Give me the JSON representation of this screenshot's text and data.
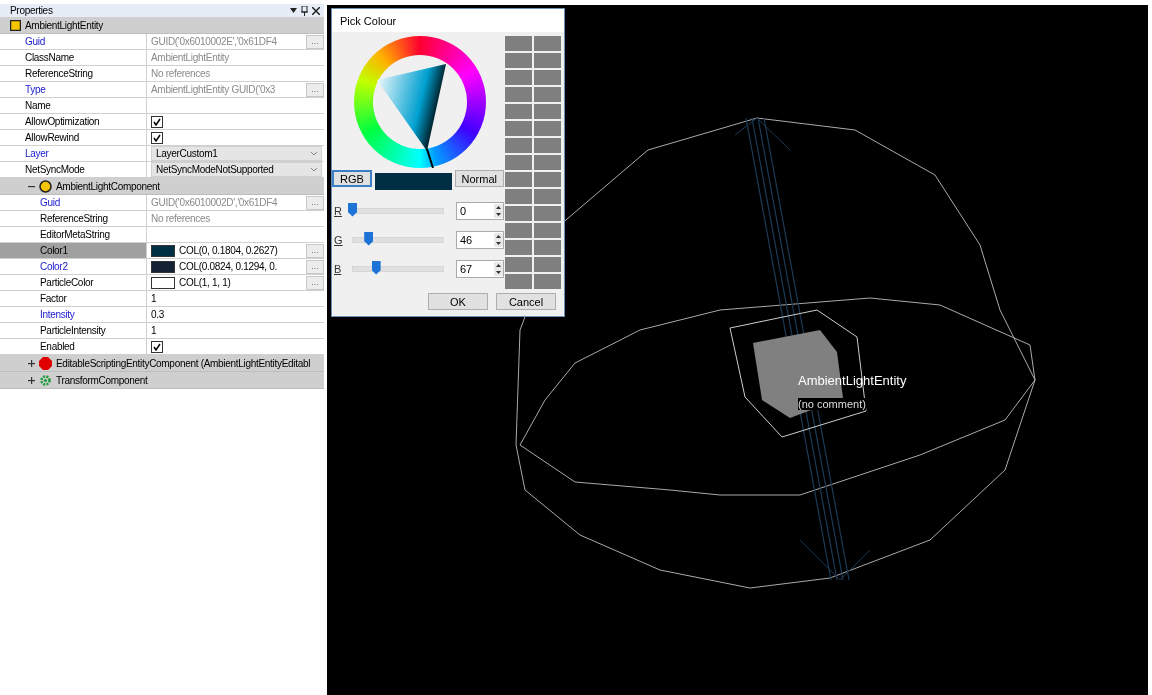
{
  "panel": {
    "title": "Properties",
    "entity": {
      "name": "AmbientLightEntity"
    },
    "rows": [
      {
        "kind": "readonly",
        "label": "Guid",
        "modified": true,
        "selected": false,
        "value": "GUID('0x6010002E','0x61DF4",
        "button": "..."
      },
      {
        "kind": "readonly",
        "label": "ClassName",
        "modified": false,
        "selected": false,
        "value": "AmbientLightEntity"
      },
      {
        "kind": "readonly",
        "label": "ReferenceString",
        "modified": false,
        "selected": false,
        "value": "No references"
      },
      {
        "kind": "readonly",
        "label": "Type",
        "modified": true,
        "selected": false,
        "value": "AmbientLightEntity GUID('0x3",
        "button": "..."
      },
      {
        "kind": "text",
        "label": "Name",
        "modified": false,
        "selected": false
      },
      {
        "kind": "check",
        "label": "AllowOptimization",
        "modified": false,
        "selected": false,
        "checked": true
      },
      {
        "kind": "check",
        "label": "AllowRewind",
        "modified": false,
        "selected": false,
        "checked": true
      },
      {
        "kind": "dropdown",
        "label": "Layer",
        "modified": true,
        "selected": false,
        "value": "LayerCustom1"
      },
      {
        "kind": "dropdown",
        "label": "NetSyncMode",
        "modified": false,
        "selected": false,
        "value": "NetSyncModeNotSupported"
      },
      {
        "kind": "group",
        "label": "AmbientLightComponent",
        "expanded": true,
        "children": [
          {
            "kind": "readonly",
            "label": "Guid",
            "modified": true,
            "selected": false,
            "value": "GUID('0x6010002D','0x61DF4",
            "button": "..."
          },
          {
            "kind": "readonly",
            "label": "ReferenceString",
            "modified": false,
            "selected": false,
            "value": "No references"
          },
          {
            "kind": "text",
            "label": "EditorMetaString",
            "modified": false,
            "selected": false
          },
          {
            "kind": "color",
            "label": "Color1",
            "modified": false,
            "selected": true,
            "color": "#002e43",
            "value": "COL(0, 0.1804, 0.2627)",
            "button": "..."
          },
          {
            "kind": "color",
            "label": "Color2",
            "modified": true,
            "selected": false,
            "color": "#152135",
            "value": "COL(0.0824, 0.1294, 0.",
            "button": "..."
          },
          {
            "kind": "color",
            "label": "ParticleColor",
            "modified": false,
            "selected": false,
            "color": "#ffffff",
            "value": "COL(1, 1, 1)",
            "button": "..."
          },
          {
            "kind": "text",
            "label": "Factor",
            "modified": false,
            "selected": false,
            "value": "1"
          },
          {
            "kind": "text",
            "label": "Intensity",
            "modified": true,
            "selected": false,
            "value": "0.3"
          },
          {
            "kind": "text",
            "label": "ParticleIntensity",
            "modified": false,
            "selected": false,
            "value": "1"
          },
          {
            "kind": "check",
            "label": "Enabled",
            "modified": false,
            "selected": false,
            "checked": true
          }
        ]
      },
      {
        "kind": "group",
        "label": "EditableScriptingEntityComponent (AmbientLightEntityEditabl",
        "expanded": false
      },
      {
        "kind": "group",
        "label": "TransformComponent",
        "expanded": false
      }
    ]
  },
  "dialog": {
    "title": "Pick Colour",
    "modes": [
      {
        "label": "RGB",
        "selected": true
      },
      {
        "label": "Normal",
        "selected": false
      }
    ],
    "channels": [
      {
        "label": "R",
        "level": 0,
        "value": "0"
      },
      {
        "label": "G",
        "level": 0.18,
        "value": "46"
      },
      {
        "label": "B",
        "level": 0.263,
        "value": "67"
      }
    ],
    "buttons": [
      "OK",
      "Cancel"
    ]
  },
  "viewport": {
    "label": "AmbientLightEntity",
    "comment": "(no comment)"
  }
}
